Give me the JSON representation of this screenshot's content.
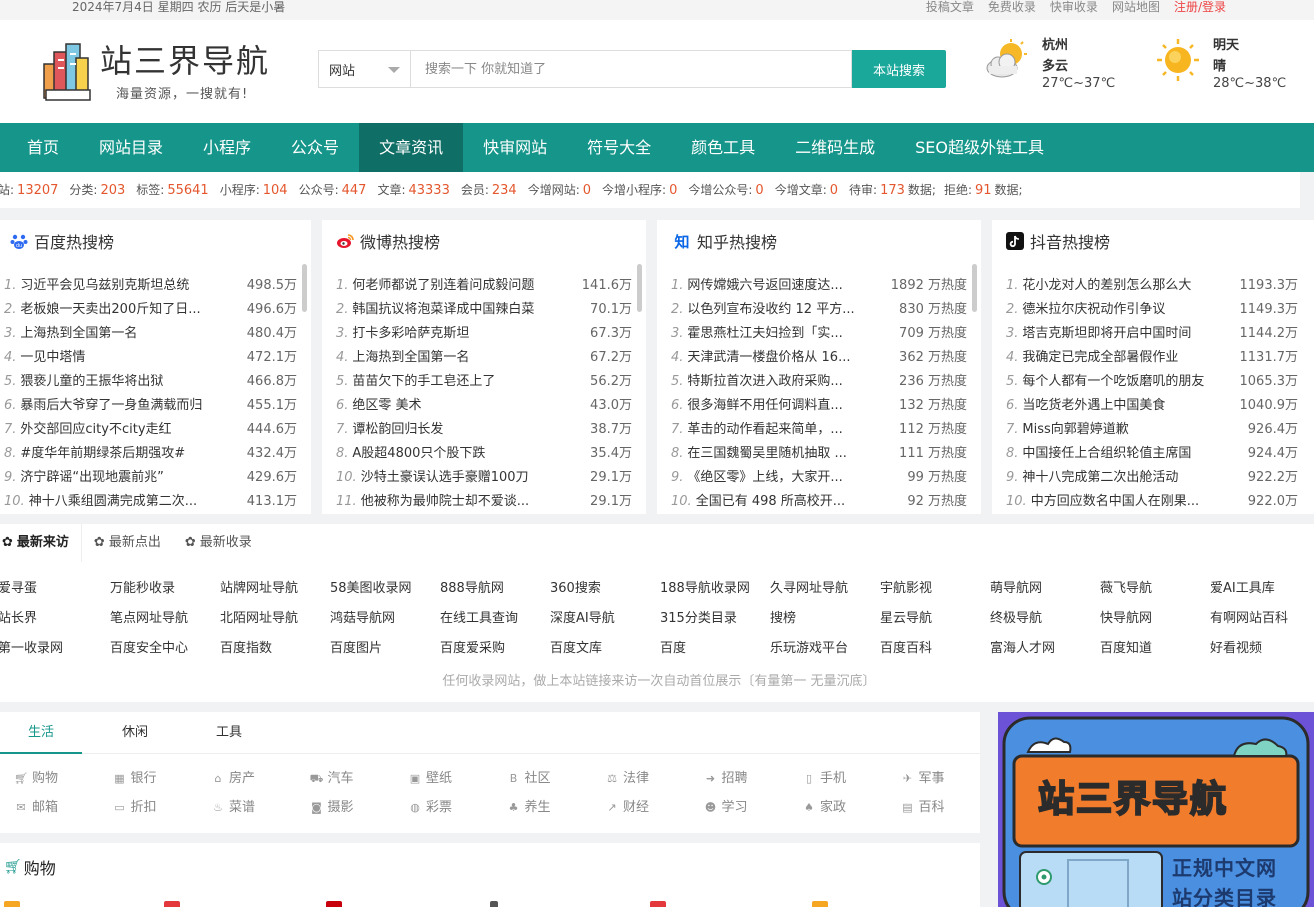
{
  "topbar": {
    "date": "2024年7月4日 星期四 农历 后天是小暑",
    "links": [
      "投稿文章",
      "免费收录",
      "快审收录",
      "网站地图"
    ],
    "register": "注册/登录"
  },
  "header": {
    "site_name": "站三界导航",
    "slogan": "海量资源，一搜就有!",
    "search_select": "网站",
    "search_placeholder": "搜索一下 你就知道了",
    "search_button": "本站搜索"
  },
  "weather": [
    {
      "city": "杭州",
      "condition": "多云",
      "temp": "27℃~37℃",
      "icon": "cloudy-sun-icon"
    },
    {
      "city": "明天",
      "condition": "晴",
      "temp": "28℃~38℃",
      "icon": "sun-icon"
    }
  ],
  "nav": {
    "items": [
      "首页",
      "网站目录",
      "小程序",
      "公众号",
      "文章资讯",
      "快审网站",
      "符号大全",
      "颜色工具",
      "二维码生成",
      "SEO超级外链工具"
    ],
    "active_index": 4
  },
  "stats": {
    "items": [
      {
        "label": "网站:",
        "value": "13207"
      },
      {
        "label": "分类:",
        "value": "203"
      },
      {
        "label": "标签:",
        "value": "55641"
      },
      {
        "label": "小程序:",
        "value": "104"
      },
      {
        "label": "公众号:",
        "value": "447"
      },
      {
        "label": "文章:",
        "value": "43333"
      },
      {
        "label": "会员:",
        "value": "234"
      },
      {
        "label": "今增网站:",
        "value": "0"
      },
      {
        "label": "今增小程序:",
        "value": "0"
      },
      {
        "label": "今增公众号:",
        "value": "0"
      },
      {
        "label": "今增文章:",
        "value": "0"
      },
      {
        "label": "待审:",
        "value": "173",
        "suffix": "数据;"
      },
      {
        "label": "拒绝:",
        "value": "91",
        "suffix": "数据;"
      }
    ]
  },
  "hot": [
    {
      "title": "百度热搜榜",
      "icon": "baidu-paw-icon",
      "items": [
        [
          "1.",
          "习近平会见乌兹别克斯坦总统",
          "498.5万"
        ],
        [
          "2.",
          "老板娘一天卖出200斤知了日...",
          "496.6万"
        ],
        [
          "3.",
          "上海热到全国第一名",
          "480.4万"
        ],
        [
          "4.",
          "一见中塔情",
          "472.1万"
        ],
        [
          "5.",
          "猥亵儿童的王振华将出狱",
          "466.8万"
        ],
        [
          "6.",
          "暴雨后大爷穿了一身鱼满载而归",
          "455.1万"
        ],
        [
          "7.",
          "外交部回应city不city走红",
          "444.6万"
        ],
        [
          "8.",
          "#度华年前期绿茶后期强攻#",
          "432.4万"
        ],
        [
          "9.",
          "济宁辟谣“出现地震前兆”",
          "429.6万"
        ],
        [
          "10.",
          "神十八乘组圆满完成第二次...",
          "413.1万"
        ]
      ]
    },
    {
      "title": "微博热搜榜",
      "icon": "weibo-icon",
      "items": [
        [
          "1.",
          "何老师都说了别连着问成毅问题",
          "141.6万"
        ],
        [
          "2.",
          "韩国抗议将泡菜译成中国辣白菜",
          "70.1万"
        ],
        [
          "3.",
          "打卡多彩哈萨克斯坦",
          "67.3万"
        ],
        [
          "4.",
          "上海热到全国第一名",
          "67.2万"
        ],
        [
          "5.",
          "苗苗欠下的手工皂还上了",
          "56.2万"
        ],
        [
          "6.",
          "绝区零 美术",
          "43.0万"
        ],
        [
          "7.",
          "谭松韵回归长发",
          "38.7万"
        ],
        [
          "8.",
          "A股超4800只个股下跌",
          "35.4万"
        ],
        [
          "10.",
          "沙特土豪误认选手豪赠100刀",
          "29.1万"
        ],
        [
          "11.",
          "他被称为最帅院士却不爱谈...",
          "29.1万"
        ]
      ]
    },
    {
      "title": "知乎热搜榜",
      "icon": "zhihu-icon",
      "items": [
        [
          "1.",
          "网传嫦娥六号返回速度达...",
          "1892 万热度"
        ],
        [
          "2.",
          "以色列宣布没收约 12 平方...",
          "830 万热度"
        ],
        [
          "3.",
          "霍思燕杜江夫妇捡到「实...",
          "709 万热度"
        ],
        [
          "4.",
          "天津武清一楼盘价格从 16...",
          "362 万热度"
        ],
        [
          "5.",
          "特斯拉首次进入政府采购...",
          "236 万热度"
        ],
        [
          "6.",
          "很多海鲜不用任何调料直...",
          "132 万热度"
        ],
        [
          "7.",
          "革击的动作看起来简单，...",
          "112 万热度"
        ],
        [
          "8.",
          "在三国魏蜀吴里随机抽取 ...",
          "111 万热度"
        ],
        [
          "9.",
          "《绝区零》上线，大家开...",
          "99 万热度"
        ],
        [
          "10.",
          "全国已有 498 所高校开...",
          "92 万热度"
        ]
      ]
    },
    {
      "title": "抖音热搜榜",
      "icon": "douyin-icon",
      "items": [
        [
          "1.",
          "花小龙对人的差别怎么那么大",
          "1193.3万"
        ],
        [
          "2.",
          "德米拉尔庆祝动作引争议",
          "1149.3万"
        ],
        [
          "3.",
          "塔吉克斯坦即将开启中国时间",
          "1144.2万"
        ],
        [
          "4.",
          "我确定已完成全部暑假作业",
          "1131.7万"
        ],
        [
          "5.",
          "每个人都有一个吃饭磨叽的朋友",
          "1065.3万"
        ],
        [
          "6.",
          "当吃货老外遇上中国美食",
          "1040.9万"
        ],
        [
          "7.",
          "Miss向郭碧婷道歉",
          "926.4万"
        ],
        [
          "8.",
          "中国接任上合组织轮值主席国",
          "924.4万"
        ],
        [
          "9.",
          "神十八完成第二次出舱活动",
          "922.2万"
        ],
        [
          "10.",
          "中方回应数名中国人在刚果...",
          "922.0万"
        ]
      ]
    }
  ],
  "recent": {
    "tabs": [
      "最新来访",
      "最新点出",
      "最新收录"
    ],
    "sites": [
      "爱寻蛋",
      "万能秒收录",
      "站牌网址导航",
      "58美图收录网",
      "888导航网",
      "360搜索",
      "188导航收录网",
      "久寻网址导航",
      "宇航影视",
      "萌导航网",
      "薇飞导航",
      "爱AI工具库",
      "站长界",
      "笔点网址导航",
      "北陌网址导航",
      "鸿菇导航网",
      "在线工具查询",
      "深度AI导航",
      "315分类目录",
      "搜榜",
      "星云导航",
      "终极导航",
      "快导航网",
      "有啊网站百科",
      "第一收录网",
      "百度安全中心",
      "百度指数",
      "百度图片",
      "百度爱采购",
      "百度文库",
      "百度",
      "乐玩游戏平台",
      "百度百科",
      "富海人才网",
      "百度知道",
      "好看视频"
    ],
    "note": "任何收录网站，做上本站链接来访一次自动首位展示〔有量第一  无量沉底〕"
  },
  "categories": {
    "tabs": [
      "生活",
      "休闲",
      "工具"
    ],
    "items": [
      {
        "label": "购物",
        "icon": "cart-icon"
      },
      {
        "label": "银行",
        "icon": "bank-icon"
      },
      {
        "label": "房产",
        "icon": "home-icon"
      },
      {
        "label": "汽车",
        "icon": "car-icon"
      },
      {
        "label": "壁纸",
        "icon": "image-icon"
      },
      {
        "label": "社区",
        "icon": "bold-b-icon"
      },
      {
        "label": "法律",
        "icon": "scale-icon"
      },
      {
        "label": "招聘",
        "icon": "sign-in-icon"
      },
      {
        "label": "手机",
        "icon": "phone-icon"
      },
      {
        "label": "军事",
        "icon": "plane-icon"
      },
      {
        "label": "邮箱",
        "icon": "mail-icon"
      },
      {
        "label": "折扣",
        "icon": "ticket-icon"
      },
      {
        "label": "菜谱",
        "icon": "chef-icon"
      },
      {
        "label": "摄影",
        "icon": "camera-icon"
      },
      {
        "label": "彩票",
        "icon": "globe-icon"
      },
      {
        "label": "养生",
        "icon": "herb-icon"
      },
      {
        "label": "财经",
        "icon": "chart-icon"
      },
      {
        "label": "学习",
        "icon": "users-icon"
      },
      {
        "label": "家政",
        "icon": "broom-icon"
      },
      {
        "label": "百科",
        "icon": "book-icon"
      }
    ]
  },
  "shopping": {
    "title": "购物"
  },
  "ad": {
    "title": "站三界导航",
    "line1": "正规中文网",
    "line2": "站分类目录"
  },
  "colors": {
    "accent": "#16968b",
    "nav_active": "#0f6e65",
    "number": "#e4572e"
  }
}
